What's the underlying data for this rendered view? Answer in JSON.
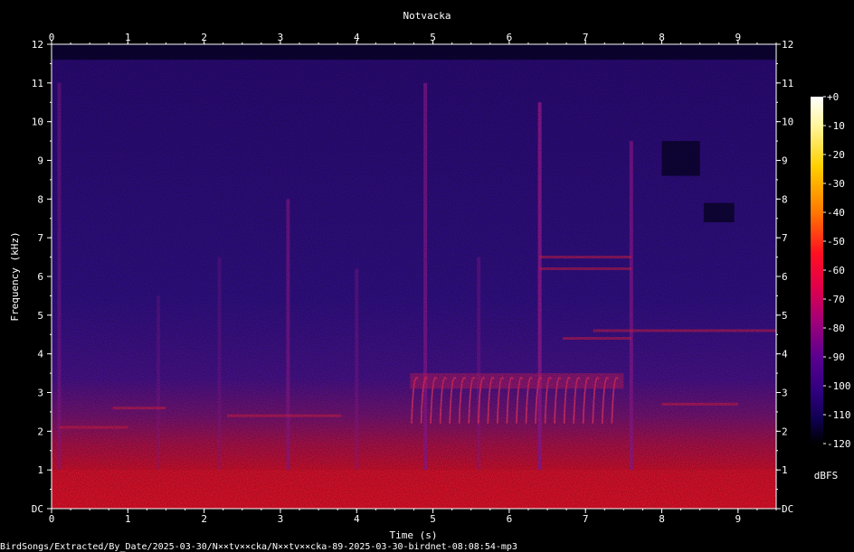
{
  "chart_data": {
    "type": "heatmap",
    "title": "Notvacka",
    "xlabel": "Time (s)",
    "ylabel": "Frequency (kHz)",
    "xlim": [
      0,
      9.5
    ],
    "ylim": [
      0,
      12
    ],
    "x_ticks": [
      "0",
      "1",
      "2",
      "3",
      "4",
      "5",
      "6",
      "7",
      "8",
      "9"
    ],
    "y_ticks": [
      "DC",
      "1",
      "2",
      "3",
      "4",
      "5",
      "6",
      "7",
      "8",
      "9",
      "10",
      "11",
      "12"
    ],
    "colorbar": {
      "label": "dBFS",
      "range": [
        -120,
        0
      ],
      "ticks": [
        "+0",
        "-10",
        "-20",
        "-30",
        "-40",
        "-50",
        "-60",
        "-70",
        "-80",
        "-90",
        "-100",
        "-110",
        "-120"
      ]
    },
    "footer": "BirdSongs/Extracted/By_Date/2025-03-30/N××tv××cka/N××tv××cka-89-2025-03-30-birdnet-08:08:54-mp3",
    "colors": {
      "background": "#000000",
      "noise": "#2a0a78",
      "low_band": "#e0102a",
      "harmonics": "#ff3060",
      "text": "#ffffff"
    }
  }
}
